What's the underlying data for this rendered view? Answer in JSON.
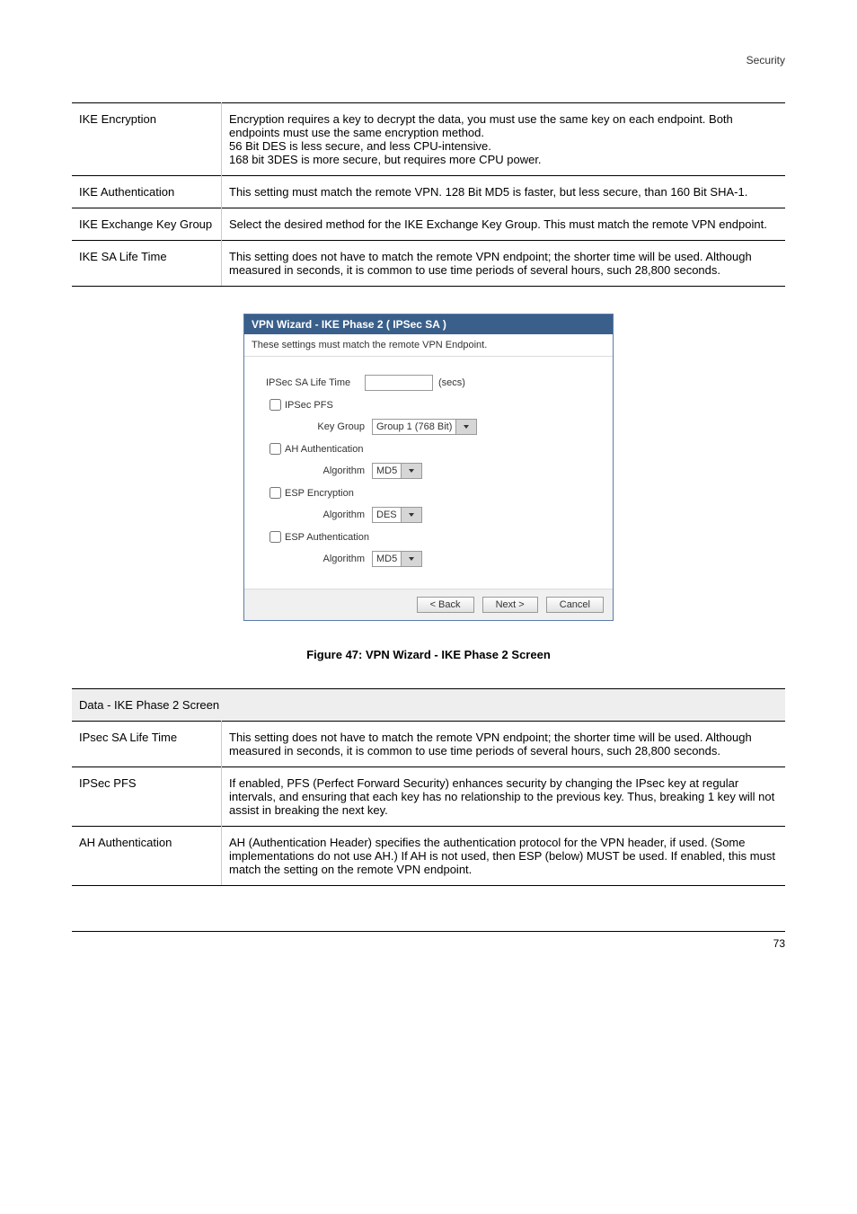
{
  "header": {
    "right": "Security"
  },
  "table1": {
    "rows": [
      {
        "label": "IKE Encryption",
        "desc": "Encryption requires a key to decrypt the data, you must use the same key on each endpoint. Both endpoints must use the same encryption method.\n56 Bit DES is less secure, and less CPU-intensive.\n168 bit 3DES is more secure, but requires more CPU power."
      },
      {
        "label": "IKE Authentication",
        "desc": "This setting must match the remote VPN. 128 Bit MD5 is faster, but less secure, than 160 Bit SHA-1."
      },
      {
        "label": "IKE Exchange Key Group",
        "desc": "Select the desired method for the IKE Exchange Key Group. This must match the remote VPN endpoint."
      },
      {
        "label": "IKE SA Life Time",
        "desc": "This setting does not have to match the remote VPN endpoint; the shorter time will be used. Although measured in seconds, it is common to use time periods of several hours, such 28,800 seconds."
      }
    ]
  },
  "fig_caption": "Figure 47: VPN Wizard - IKE Phase 2 Screen",
  "dialog": {
    "title": "VPN Wizard - IKE Phase 2 ( IPSec SA )",
    "subtitle": "These settings must match the remote VPN Endpoint.",
    "fields": {
      "salife_label": "IPSec SA Life Time",
      "salife_value": "",
      "salife_unit": "(secs)",
      "pfs_label": "IPSec PFS",
      "keygroup_label": "Key Group",
      "keygroup_value": "Group 1 (768 Bit)",
      "ah_label": "AH Authentication",
      "ah_algo_label": "Algorithm",
      "ah_algo_value": "MD5",
      "espenc_label": "ESP Encryption",
      "espenc_algo_label": "Algorithm",
      "espenc_algo_value": "DES",
      "espauth_label": "ESP Authentication",
      "espauth_algo_label": "Algorithm",
      "espauth_algo_value": "MD5"
    },
    "buttons": {
      "back": "< Back",
      "next": "Next >",
      "cancel": "Cancel"
    }
  },
  "table2": {
    "heading": "Data - IKE Phase 2 Screen",
    "rows": [
      {
        "label": "IPsec SA Life Time",
        "desc": "This setting does not have to match the remote VPN endpoint; the shorter time will be used. Although measured in seconds, it is common to use time periods of several hours, such 28,800 seconds."
      },
      {
        "label": "IPSec PFS",
        "desc": "If enabled, PFS (Perfect Forward Security) enhances security by changing the IPsec key at regular intervals, and ensuring that each key has no relationship to the previous key. Thus, breaking 1 key will not assist in breaking the next key."
      },
      {
        "label": "AH Authentication",
        "desc": "AH (Authentication Header) specifies the authentication protocol for the VPN header, if used. (Some implementations do not use AH.) If AH is not used, then ESP (below) MUST be used. If enabled, this must match the setting on the remote VPN endpoint."
      }
    ]
  },
  "footer": {
    "page": "73"
  }
}
